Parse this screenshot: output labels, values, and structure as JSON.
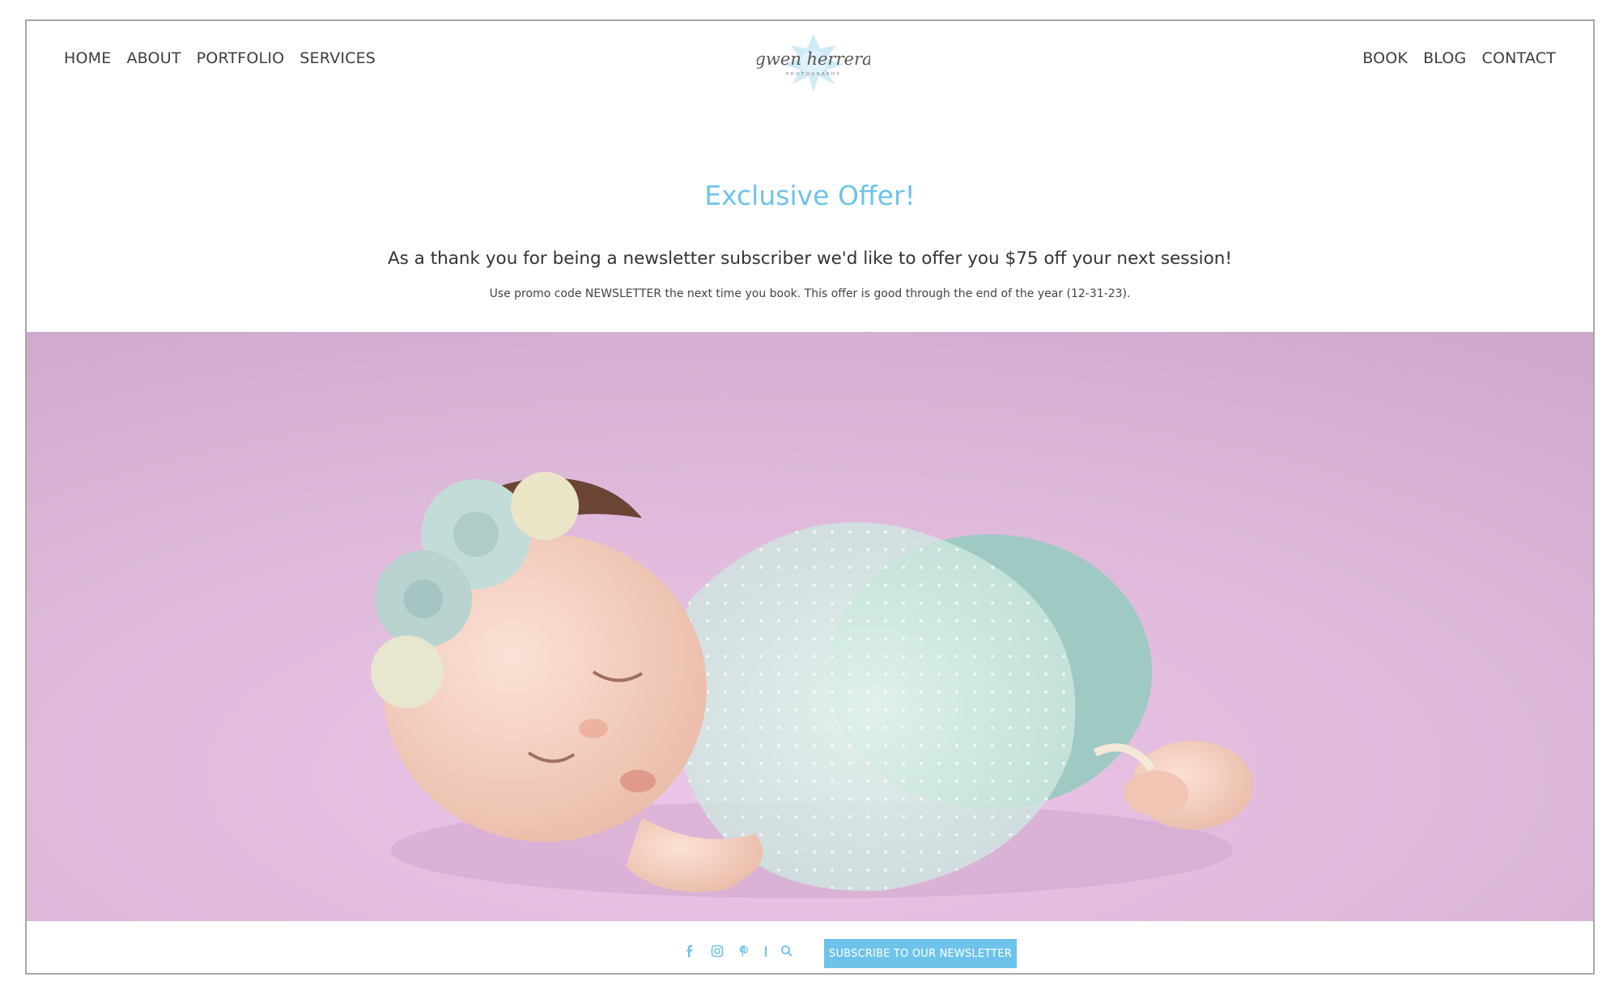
{
  "brand": {
    "logo_script": "gwen herrera",
    "logo_tagline": "PHOTOGRAPHY",
    "accent_color": "#6ec3ea"
  },
  "nav": {
    "left": [
      {
        "label": "HOME"
      },
      {
        "label": "ABOUT"
      },
      {
        "label": "PORTFOLIO"
      },
      {
        "label": "SERVICES"
      }
    ],
    "right": [
      {
        "label": "BOOK"
      },
      {
        "label": "BLOG"
      },
      {
        "label": "CONTACT"
      }
    ]
  },
  "offer": {
    "title": "Exclusive Offer!",
    "lead": "As a thank you for being a newsletter subscriber we'd like to offer you $75 off your next session!",
    "note": "Use promo code NEWSLETTER the next time you book. This offer is good through the end of the year (12-31-23)."
  },
  "hero": {
    "background_color": "#dcb7d8"
  },
  "footer": {
    "social_icons": [
      "facebook-icon",
      "instagram-icon",
      "pinterest-icon",
      "search-icon"
    ],
    "subscribe_label": "SUBSCRIBE TO OUR NEWSLETTER"
  }
}
